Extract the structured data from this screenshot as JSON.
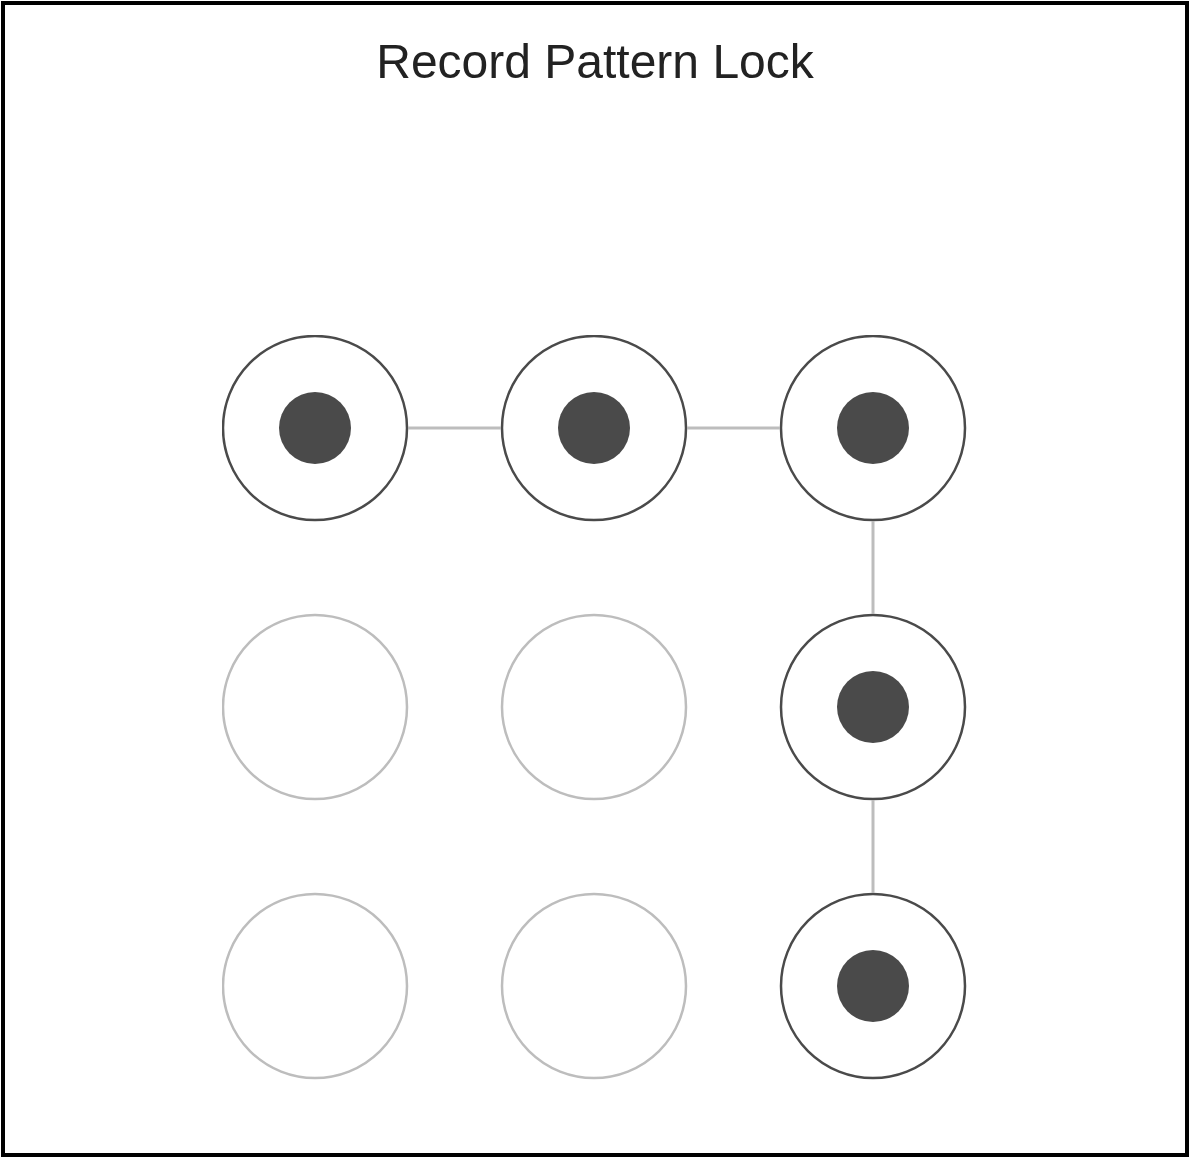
{
  "title": "Record Pattern Lock",
  "nodes": [
    {
      "selected": true,
      "link_right": true,
      "link_down": false
    },
    {
      "selected": true,
      "link_right": true,
      "link_down": false
    },
    {
      "selected": true,
      "link_right": false,
      "link_down": true
    },
    {
      "selected": false,
      "link_right": false,
      "link_down": false
    },
    {
      "selected": false,
      "link_right": false,
      "link_down": false
    },
    {
      "selected": true,
      "link_right": false,
      "link_down": true
    },
    {
      "selected": false,
      "link_right": false,
      "link_down": false
    },
    {
      "selected": false,
      "link_right": false,
      "link_down": false
    },
    {
      "selected": true,
      "link_right": false,
      "link_down": false
    }
  ]
}
